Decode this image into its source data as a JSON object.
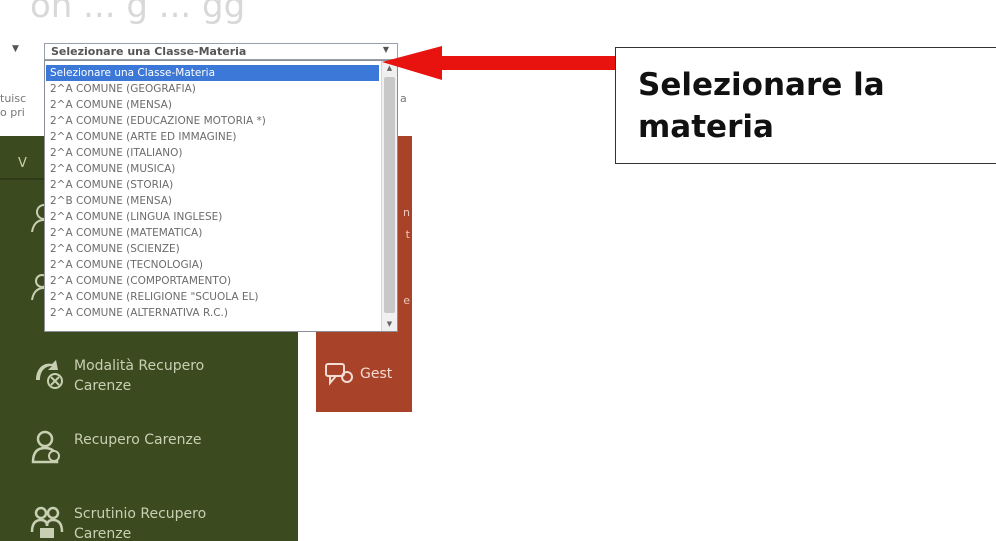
{
  "header": {
    "title_faint": "on ... g ... gg"
  },
  "background": {
    "left_fragments": [
      "tuisc",
      "o pri"
    ],
    "right_fragment": "a",
    "left_panel_letter": "V",
    "left_panel_items": [
      {
        "label_line1": "Modalità Recupero",
        "label_line2": "Carenze",
        "icon": "recovery-mode-icon"
      },
      {
        "label_line1": "Recupero Carenze",
        "label_line2": "",
        "icon": "user-recovery-icon"
      },
      {
        "label_line1": "Scrutinio Recupero",
        "label_line2": "Carenze",
        "icon": "group-scrutiny-icon"
      }
    ],
    "right_panel_label": "Gest",
    "right_panel_fragments": [
      "n",
      "t",
      "e"
    ]
  },
  "select": {
    "value": "Selezionare una Classe-Materia",
    "options": [
      "Selezionare una Classe-Materia",
      "2^A COMUNE (GEOGRAFIA)",
      "2^A COMUNE (MENSA)",
      "2^A COMUNE (EDUCAZIONE MOTORIA *)",
      "2^A COMUNE (ARTE ED IMMAGINE)",
      "2^A COMUNE (ITALIANO)",
      "2^A COMUNE (MUSICA)",
      "2^A COMUNE (STORIA)",
      "2^B COMUNE (MENSA)",
      "2^A COMUNE (LINGUA INGLESE)",
      "2^A COMUNE (MATEMATICA)",
      "2^A COMUNE (SCIENZE)",
      "2^A COMUNE (TECNOLOGIA)",
      "2^A COMUNE (COMPORTAMENTO)",
      "2^A COMUNE (RELIGIONE \"SCUOLA EL)",
      "2^A COMUNE (ALTERNATIVA R.C.)"
    ]
  },
  "callout": {
    "line1": "Selezionare la",
    "line2": "materia"
  },
  "colors": {
    "arrow": "#e8120f",
    "left_panel": "#3b4a1f",
    "right_panel": "#a8432a",
    "selected_option": "#3c78d8"
  }
}
